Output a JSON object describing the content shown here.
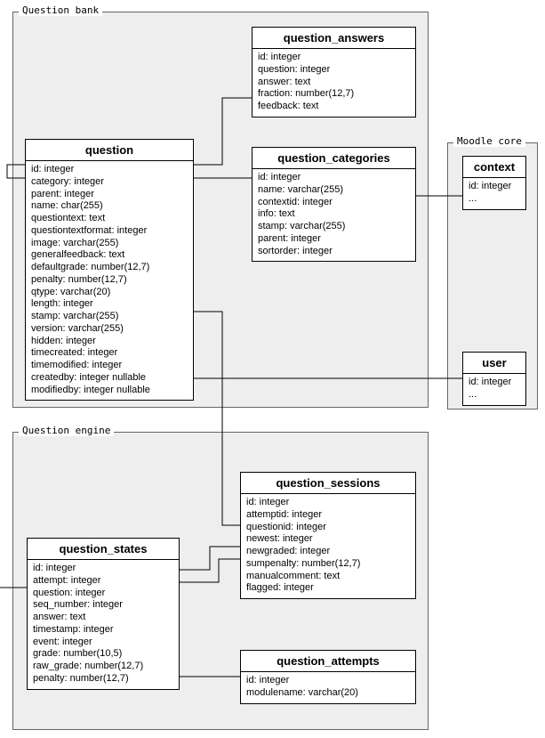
{
  "groups": {
    "question_bank": {
      "label": "Question bank"
    },
    "moodle_core": {
      "label": "Moodle core"
    },
    "question_engine": {
      "label": "Question engine"
    }
  },
  "entities": {
    "question": {
      "title": "question",
      "fields": [
        "id: integer",
        "category: integer",
        "parent: integer",
        "name: char(255)",
        "questiontext: text",
        "questiontextformat: integer",
        "image: varchar(255)",
        "generalfeedback: text",
        "defaultgrade: number(12,7)",
        "penalty: number(12,7)",
        "qtype: varchar(20)",
        "length: integer",
        "stamp: varchar(255)",
        "version: varchar(255)",
        "hidden: integer",
        "timecreated: integer",
        "timemodified: integer",
        "createdby: integer nullable",
        "modifiedby: integer nullable"
      ]
    },
    "question_answers": {
      "title": "question_answers",
      "fields": [
        "id: integer",
        "question: integer",
        "answer: text",
        "fraction: number(12,7)",
        "feedback: text"
      ]
    },
    "question_categories": {
      "title": "question_categories",
      "fields": [
        "id: integer",
        "name: varchar(255)",
        "contextid: integer",
        "info: text",
        "stamp: varchar(255)",
        "parent: integer",
        "sortorder: integer"
      ]
    },
    "context": {
      "title": "context",
      "fields": [
        "id: integer",
        "..."
      ]
    },
    "user": {
      "title": "user",
      "fields": [
        "id: integer",
        "..."
      ]
    },
    "question_sessions": {
      "title": "question_sessions",
      "fields": [
        "id: integer",
        "attemptid: integer",
        "questionid: integer",
        "newest: integer",
        "newgraded: integer",
        "sumpenalty: number(12,7)",
        "manualcomment: text",
        "flagged: integer"
      ]
    },
    "question_states": {
      "title": "question_states",
      "fields": [
        "id: integer",
        "attempt: integer",
        "question: integer",
        "seq_number: integer",
        "answer: text",
        "timestamp: integer",
        "event: integer",
        "grade: number(10,5)",
        "raw_grade: number(12,7)",
        "penalty: number(12,7)"
      ]
    },
    "question_attempts": {
      "title": "question_attempts",
      "fields": [
        "id: integer",
        "modulename: varchar(20)"
      ]
    }
  }
}
